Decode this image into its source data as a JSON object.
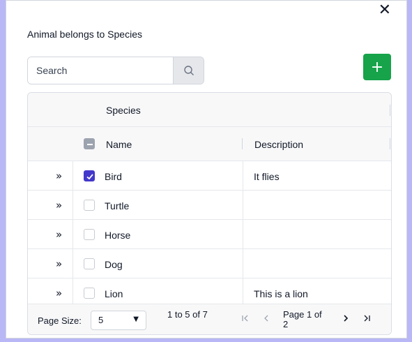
{
  "dialog": {
    "title": "Animal belongs to Species",
    "close_glyph": "✕"
  },
  "search": {
    "placeholder": "Search",
    "value": "",
    "icon": "search-icon"
  },
  "toolbar": {
    "add_glyph": "+",
    "add_color": "#16a34a"
  },
  "grid": {
    "group_header": "Species",
    "columns": [
      "Name",
      "Description"
    ],
    "expander_glyph": "»",
    "rows": [
      {
        "name": "Bird",
        "description": "It flies",
        "selected": true
      },
      {
        "name": "Turtle",
        "description": "",
        "selected": false
      },
      {
        "name": "Horse",
        "description": "",
        "selected": false
      },
      {
        "name": "Dog",
        "description": "",
        "selected": false
      },
      {
        "name": "Lion",
        "description": "This is a lion",
        "selected": false
      }
    ],
    "checkbox_color": "#4338ca"
  },
  "pager": {
    "page_size_label": "Page Size:",
    "page_size": "5",
    "range_text": "1 to 5 of 7",
    "page_text": "Page 1 of 2",
    "first_glyph": "|<",
    "prev_glyph": "<",
    "next_glyph": ">",
    "last_glyph": ">|"
  }
}
